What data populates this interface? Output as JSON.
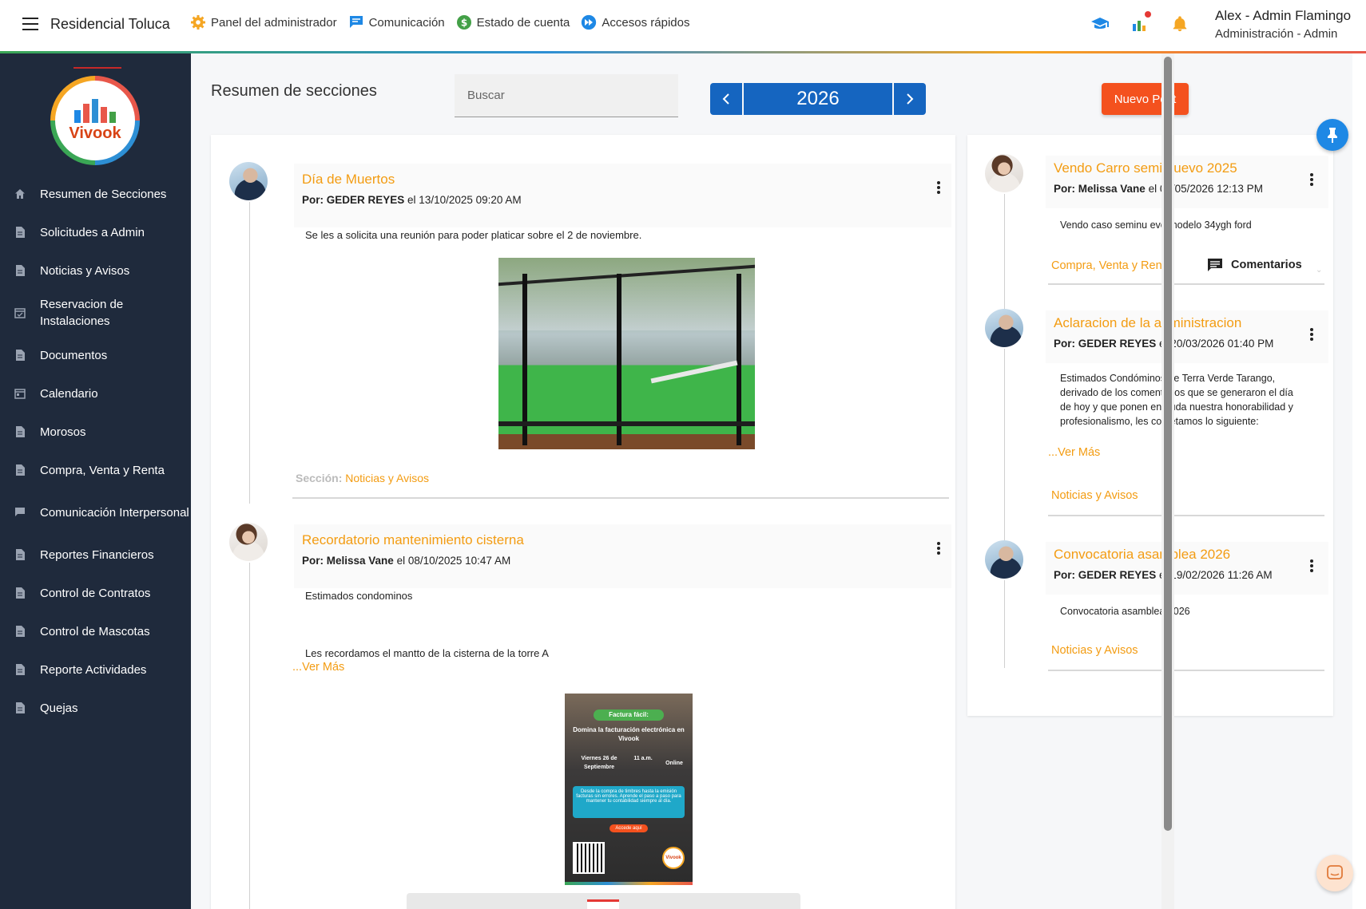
{
  "header": {
    "brand": "Residencial Toluca",
    "nav": [
      {
        "label": "Panel del administrador",
        "icon": "gear-icon"
      },
      {
        "label": "Comunicación",
        "icon": "chat-icon"
      },
      {
        "label": "Estado de cuenta",
        "icon": "dollar-icon"
      },
      {
        "label": "Accesos rápidos",
        "icon": "fast-forward-icon"
      }
    ],
    "user_name": "Alex - Admin Flamingo",
    "user_role": "Administración - Admin"
  },
  "sidebar": {
    "logo_text": "Vivook",
    "items": [
      {
        "label": "Resumen de Secciones",
        "icon": "home-icon"
      },
      {
        "label": "Solicitudes a Admin",
        "icon": "document-icon"
      },
      {
        "label": "Noticias y Avisos",
        "icon": "document-icon"
      },
      {
        "label": "Reservacion de Instalaciones",
        "icon": "calendar-check-icon"
      },
      {
        "label": "Documentos",
        "icon": "document-icon"
      },
      {
        "label": "Calendario",
        "icon": "calendar-icon"
      },
      {
        "label": "Morosos",
        "icon": "document-icon"
      },
      {
        "label": "Compra, Venta y Renta",
        "icon": "document-icon"
      },
      {
        "label": "Comunicación Interpersonal",
        "icon": "chat-icon"
      },
      {
        "label": "Reportes Financieros",
        "icon": "document-icon"
      },
      {
        "label": "Control de Contratos",
        "icon": "document-icon"
      },
      {
        "label": "Control de Mascotas",
        "icon": "document-icon"
      },
      {
        "label": "Reporte Actividades",
        "icon": "document-icon"
      },
      {
        "label": "Quejas",
        "icon": "document-icon"
      }
    ]
  },
  "main": {
    "title": "Resumen de secciones",
    "search_placeholder": "Buscar",
    "year": "2026",
    "new_post_label": "Nuevo Post"
  },
  "feed": {
    "section_label": "Sección:",
    "posts": [
      {
        "title": "Día de Muertos",
        "author": "Por: GEDER REYES",
        "date": "el 13/10/2025 09:20 AM",
        "body": "Se les a solicita una reunión para poder platicar sobre el 2 de noviembre.",
        "section": "Noticias y Avisos"
      },
      {
        "title": "Recordatorio mantenimiento cisterna",
        "author": "Por: Melissa Vane",
        "date": "el 08/10/2025 10:47 AM",
        "body_1": "Estimados condominos",
        "body_2": "Les recordamos el mantto de la cisterna de la torre A",
        "ver_mas": "...Ver Más",
        "poster": {
          "pill": "Factura fácil:",
          "headline": "Domina la facturación electrónica en Vivook",
          "date": "Viernes 26 de Septiembre",
          "time": "11 a.m.",
          "mode": "Online",
          "blurb": "Desde la compra de timbres hasta la emisión facturas sin errores. Aprende el paso a paso para mantener tu contabilidad siempre al día.",
          "button": "Accede aquí",
          "logo": "Vivook"
        }
      }
    ]
  },
  "side_feed": {
    "comments_label": "Comentarios",
    "posts": [
      {
        "title": "Vendo Carro semi nuevo 2025",
        "author": "Por: Melissa Vane",
        "date": "el 04/05/2026 12:13 PM",
        "body": "Vendo caso seminu evo modelo 34ygh ford",
        "section": "Compra, Venta y Renta"
      },
      {
        "title": "Aclaracion de la administracion",
        "author": "Por: GEDER REYES",
        "date": "el 20/03/2026 01:40 PM",
        "body": "Estimados Condóminos de Terra Verde Tarango, derivado de los comentarios que se generaron el día de hoy y que ponen en duda nuestra honorabilidad y profesionalismo, les cometamos lo siguiente:",
        "ver_mas": "...Ver Más",
        "section": "Noticias y Avisos"
      },
      {
        "title": "Convocatoria asamblea 2026",
        "author": "Por: GEDER REYES",
        "date": "el 19/02/2026 11:26 AM",
        "body": "Convocatoria asamblea 2026",
        "section": "Noticias y Avisos"
      }
    ]
  },
  "colors": {
    "accent_orange": "#f39c12",
    "primary_blue": "#1565c0",
    "button_orange": "#f4511e",
    "sidebar_bg": "#1f2a3c"
  }
}
